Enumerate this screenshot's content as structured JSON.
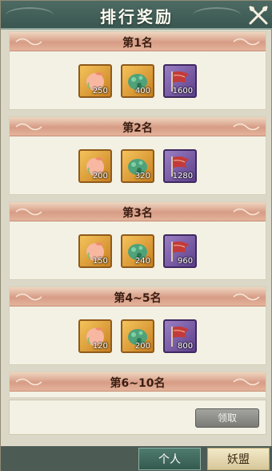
{
  "window": {
    "title": "排行奖励"
  },
  "icons": {
    "close": "close-swords-icon",
    "peach": "peach-icon",
    "jade": "jade-beast-icon",
    "banner": "banner-flag-icon"
  },
  "colors": {
    "header": "#d79c86",
    "title_bar": "#3a5650",
    "item_orange": "#c9801f",
    "item_purple": "#5d3f8a"
  },
  "ranks": [
    {
      "title": "第1名",
      "rewards": [
        {
          "icon": "peach-icon",
          "qty": "250"
        },
        {
          "icon": "jade-beast-icon",
          "qty": "400"
        },
        {
          "icon": "banner-flag-icon",
          "qty": "1600"
        }
      ]
    },
    {
      "title": "第2名",
      "rewards": [
        {
          "icon": "peach-icon",
          "qty": "200"
        },
        {
          "icon": "jade-beast-icon",
          "qty": "320"
        },
        {
          "icon": "banner-flag-icon",
          "qty": "1280"
        }
      ]
    },
    {
      "title": "第3名",
      "rewards": [
        {
          "icon": "peach-icon",
          "qty": "150"
        },
        {
          "icon": "jade-beast-icon",
          "qty": "240"
        },
        {
          "icon": "banner-flag-icon",
          "qty": "960"
        }
      ]
    },
    {
      "title": "第4~5名",
      "rewards": [
        {
          "icon": "peach-icon",
          "qty": "120"
        },
        {
          "icon": "jade-beast-icon",
          "qty": "200"
        },
        {
          "icon": "banner-flag-icon",
          "qty": "800"
        }
      ]
    },
    {
      "title": "第6~10名",
      "rewards": []
    }
  ],
  "footer": {
    "claim_label": "领取"
  },
  "tabs": {
    "personal": "个人",
    "alliance": "妖盟"
  }
}
